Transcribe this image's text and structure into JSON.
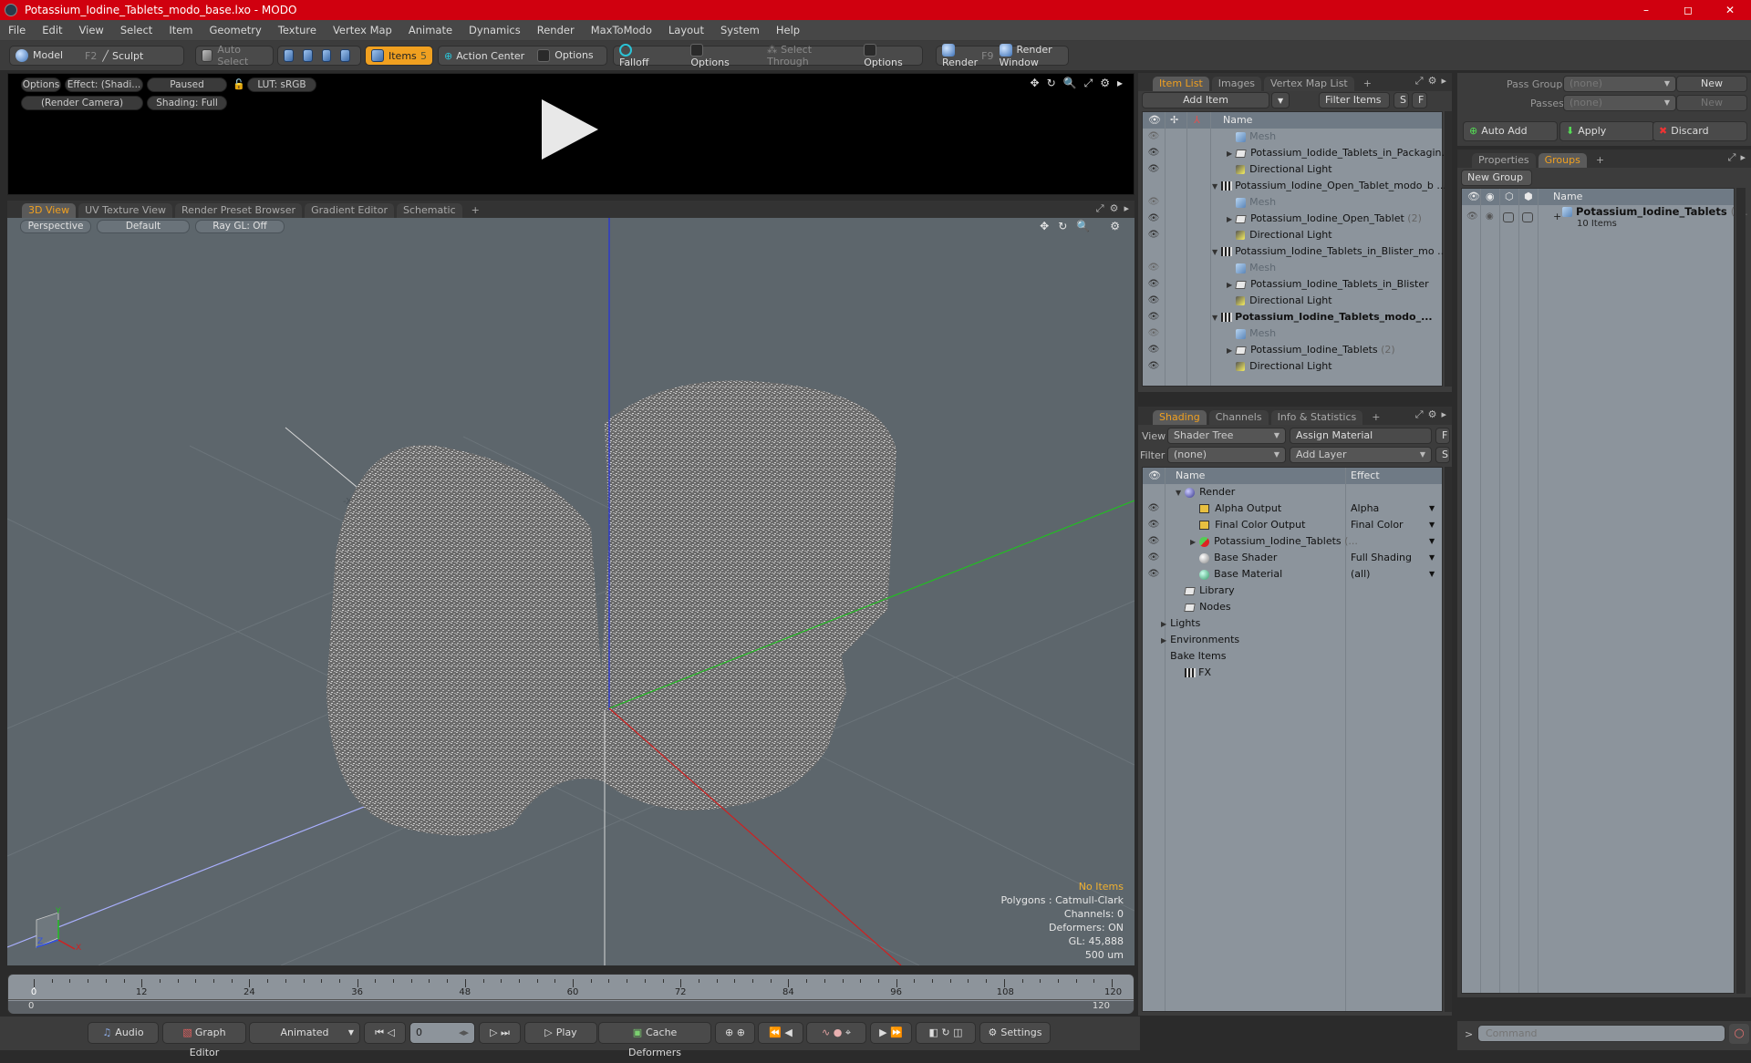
{
  "window": {
    "title": "Potassium_Iodine_Tablets_modo_base.lxo - MODO",
    "controls": [
      "–",
      "◻",
      "✕"
    ]
  },
  "menu": [
    "File",
    "Edit",
    "View",
    "Select",
    "Item",
    "Geometry",
    "Texture",
    "Vertex Map",
    "Animate",
    "Dynamics",
    "Render",
    "MaxToModo",
    "Layout",
    "System",
    "Help"
  ],
  "toolbar": {
    "model": "Model",
    "model_key": "F2",
    "sculpt": "Sculpt",
    "auto_select": "Auto Select",
    "items": "Items",
    "items_count": "5",
    "action_center": "Action Center",
    "options1": "Options",
    "falloff": "Falloff",
    "options2": "Options",
    "select_through": "Select Through",
    "options3": "Options",
    "render": "Render",
    "render_key": "F9",
    "render_window": "Render Window"
  },
  "render_view": {
    "options": "Options",
    "effect": "Effect: (Shadi...",
    "paused": "Paused",
    "lut": "LUT: sRGB",
    "camera": "(Render Camera)",
    "shading": "Shading: Full"
  },
  "viewport_tabs": [
    {
      "label": "3D View",
      "active": true
    },
    {
      "label": "UV Texture View"
    },
    {
      "label": "Render Preset Browser"
    },
    {
      "label": "Gradient Editor"
    },
    {
      "label": "Schematic"
    },
    {
      "label": "+"
    }
  ],
  "viewport": {
    "perspective": "Perspective",
    "default": "Default",
    "raygl": "Ray GL: Off",
    "axis_label": "-X",
    "stats": {
      "items": "No Items",
      "polygons": "Polygons : Catmull-Clark",
      "channels": "Channels: 0",
      "deformers": "Deformers: ON",
      "gl": "GL: 45,888",
      "unit": "500 um"
    }
  },
  "timeline": {
    "ticks": [
      "0",
      "12",
      "24",
      "36",
      "48",
      "60",
      "72",
      "84",
      "96",
      "108",
      "120"
    ],
    "start": "0",
    "end": "120",
    "end2": "120"
  },
  "transport": {
    "audio": "Audio",
    "graph_editor": "Graph Editor",
    "animated": "Animated",
    "frame": "0",
    "play": "Play",
    "cache_deformers": "Cache Deformers",
    "settings": "Settings"
  },
  "item_list": {
    "tabs": [
      {
        "label": "Item List",
        "active": true
      },
      {
        "label": "Images"
      },
      {
        "label": "Vertex Map List"
      },
      {
        "label": "+"
      }
    ],
    "add_item": "Add Item",
    "filter": "Filter Items",
    "s": "S",
    "f": "F",
    "col_name": "Name",
    "rows": [
      {
        "indent": 2,
        "icon": "mesh",
        "label": "Mesh",
        "dim": true,
        "eye": true
      },
      {
        "indent": 2,
        "icon": "folder",
        "label": "Potassium_Iodide_Tablets_in_Packagin...",
        "expand": "▶",
        "eye": true
      },
      {
        "indent": 2,
        "icon": "light",
        "label": "Directional Light",
        "eye": true
      },
      {
        "indent": 1,
        "icon": "scene",
        "label": "Potassium_Iodine_Open_Tablet_modo_b ...",
        "expand": "▼"
      },
      {
        "indent": 2,
        "icon": "mesh",
        "label": "Mesh",
        "dim": true,
        "eye": true
      },
      {
        "indent": 2,
        "icon": "folder",
        "label": "Potassium_Iodine_Open_Tablet",
        "count": "(2)",
        "expand": "▶",
        "eye": true
      },
      {
        "indent": 2,
        "icon": "light",
        "label": "Directional Light",
        "eye": true
      },
      {
        "indent": 1,
        "icon": "scene",
        "label": "Potassium_Iodine_Tablets_in_Blister_mo ...",
        "expand": "▼"
      },
      {
        "indent": 2,
        "icon": "mesh",
        "label": "Mesh",
        "dim": true,
        "eye": true
      },
      {
        "indent": 2,
        "icon": "folder",
        "label": "Potassium_Iodine_Tablets_in_Blister",
        "expand": "▶",
        "eye": true
      },
      {
        "indent": 2,
        "icon": "light",
        "label": "Directional Light",
        "eye": true
      },
      {
        "indent": 1,
        "icon": "scene",
        "label": "Potassium_Iodine_Tablets_modo_...",
        "expand": "▼",
        "bold": true,
        "eye": true
      },
      {
        "indent": 2,
        "icon": "mesh",
        "label": "Mesh",
        "dim": true,
        "eye": true
      },
      {
        "indent": 2,
        "icon": "folder",
        "label": "Potassium_Iodine_Tablets",
        "count": "(2)",
        "expand": "▶",
        "eye": true
      },
      {
        "indent": 2,
        "icon": "light",
        "label": "Directional Light",
        "eye": true
      }
    ]
  },
  "shading": {
    "tabs": [
      {
        "label": "Shading",
        "active": true
      },
      {
        "label": "Channels"
      },
      {
        "label": "Info & Statistics"
      },
      {
        "label": "+"
      }
    ],
    "view_label": "View",
    "view_value": "Shader Tree",
    "assign_material": "Assign Material",
    "f": "F",
    "filter_label": "Filter",
    "filter_value": "(none)",
    "add_layer": "Add Layer",
    "s": "S",
    "col_name": "Name",
    "col_effect": "Effect",
    "rows": [
      {
        "indent": 1,
        "icon": "render",
        "label": "Render",
        "expand": "▼"
      },
      {
        "indent": 2,
        "icon": "output",
        "label": "Alpha Output",
        "effect": "Alpha",
        "eye": true
      },
      {
        "indent": 2,
        "icon": "output",
        "label": "Final Color Output",
        "effect": "Final Color",
        "eye": true
      },
      {
        "indent": 2,
        "icon": "material-group",
        "label": "Potassium_Iodine_Tablets",
        "count": "(...",
        "effect": "",
        "expand": "▶",
        "eye": true
      },
      {
        "indent": 2,
        "icon": "shader",
        "label": "Base Shader",
        "effect": "Full Shading",
        "eye": true
      },
      {
        "indent": 2,
        "icon": "material",
        "label": "Base Material",
        "effect": "(all)",
        "eye": true
      },
      {
        "indent": 1,
        "icon": "folder",
        "label": "Library"
      },
      {
        "indent": 1,
        "icon": "folder",
        "label": "Nodes"
      },
      {
        "indent": 0,
        "icon": "",
        "label": "Lights",
        "expand": "▶"
      },
      {
        "indent": 0,
        "icon": "",
        "label": "Environments",
        "expand": "▶"
      },
      {
        "indent": 0,
        "icon": "",
        "label": "Bake Items"
      },
      {
        "indent": 1,
        "icon": "scene",
        "label": "FX"
      }
    ]
  },
  "passes": {
    "pass_groups_label": "Pass Groups",
    "pass_groups_value": "(none)",
    "new1": "New",
    "passes_label": "Passes",
    "passes_value": "(none)",
    "new2": "New",
    "auto_add": "Auto Add",
    "apply": "Apply",
    "discard": "Discard"
  },
  "groups": {
    "tabs": [
      {
        "label": "Properties"
      },
      {
        "label": "Groups",
        "active": true
      },
      {
        "label": "+"
      }
    ],
    "new_group": "New Group",
    "col_name": "Name",
    "item_name": "Potassium_Iodine_Tablets",
    "item_suffix": "( ...",
    "item_count": "10 Items"
  },
  "command": {
    "prompt": ">",
    "placeholder": "Command"
  },
  "colors": {
    "title_bar": "#d0000f",
    "accent": "#f0a020",
    "axis_x": "#d02020",
    "axis_y": "#20c020",
    "axis_z": "#2020d0"
  }
}
